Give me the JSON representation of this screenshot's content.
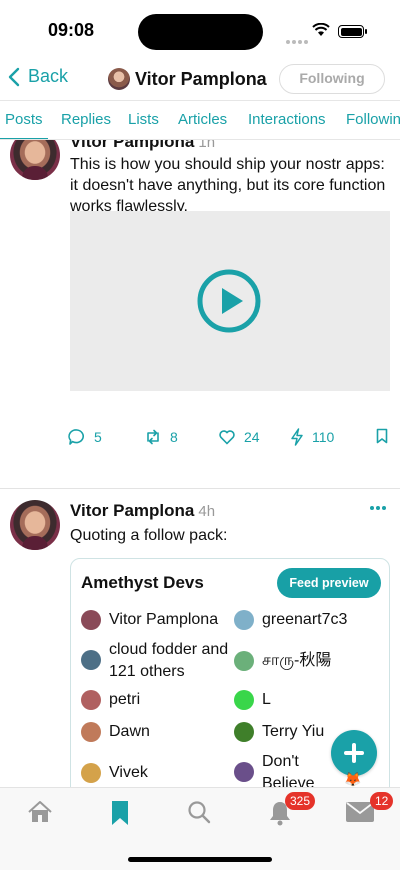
{
  "status_bar": {
    "time": "09:08"
  },
  "header": {
    "back_label": "Back",
    "profile_name": "Vitor Pamplona",
    "follow_button": "Following"
  },
  "tabs": [
    "Posts",
    "Replies",
    "Lists",
    "Articles",
    "Interactions",
    "Following"
  ],
  "active_tab": "Posts",
  "posts": [
    {
      "author": "Vitor Pamplona",
      "ago": "1h",
      "text": "This is how you should ship your nostr apps: it doesn't have anything, but its core function works flawlessly.",
      "media": "video",
      "actions": {
        "replies": "5",
        "boosts": "8",
        "likes": "24",
        "zaps": "110"
      }
    },
    {
      "author": "Vitor Pamplona",
      "ago": "4h",
      "text": "Quoting a follow pack:",
      "pack": {
        "title": "Amethyst Devs",
        "button": "Feed preview",
        "members_left": [
          {
            "name": "Vitor Pamplona",
            "color": "#8a4a58"
          },
          {
            "name": "cloud fodder and 121 others",
            "color": "#4d6f86"
          },
          {
            "name": "petri",
            "color": "#b06060"
          },
          {
            "name": "Dawn",
            "color": "#c07a5a"
          },
          {
            "name": "Vivek",
            "color": "#d4a24a"
          }
        ],
        "members_right": [
          {
            "name": "greenart7c3",
            "color": "#7fb0c9"
          },
          {
            "name": "சாரு-秋陽",
            "color": "#6bb07a"
          },
          {
            "name": "L",
            "color": "#39d64a"
          },
          {
            "name": "Terry Yiu",
            "color": "#3f7f2a"
          },
          {
            "name": "Don't Believe The Hype",
            "color": "#6a4f8a"
          }
        ]
      }
    }
  ],
  "bottom_nav": {
    "notifications_badge": "325",
    "messages_badge": "12"
  },
  "colors": {
    "accent": "#1aa1a8",
    "badge": "#e5332a"
  }
}
